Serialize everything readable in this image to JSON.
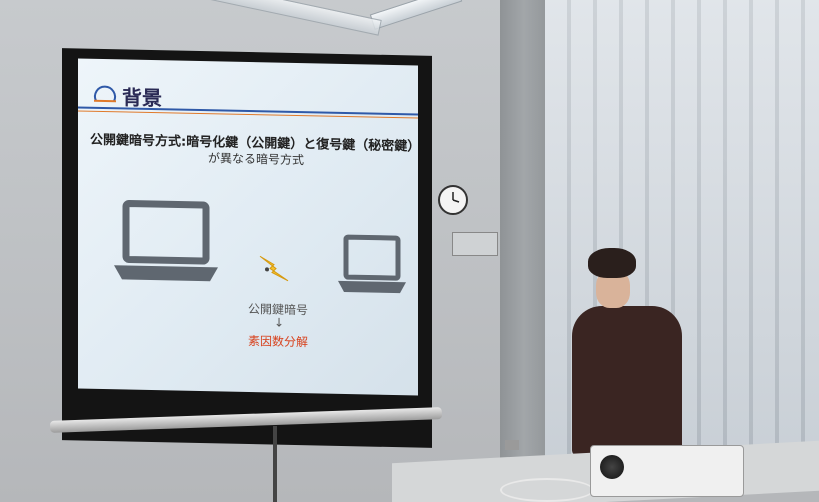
{
  "slide": {
    "title": "背景",
    "line1": "公開鍵暗号方式:暗号化鍵（公開鍵）と復号鍵（秘密鍵）",
    "line2": "が異なる暗号方式",
    "method": "公開鍵暗号",
    "arrow": "↓",
    "factor": "素因数分解"
  },
  "colors": {
    "title": "#2a2a55",
    "header_line": "#2f59a8",
    "accent_line": "#e07a2b",
    "factor_text": "#d8431f"
  },
  "icons": {
    "left_device": "laptop-icon",
    "right_device": "laptop-icon",
    "attack": "lightning-bolt-icon"
  }
}
